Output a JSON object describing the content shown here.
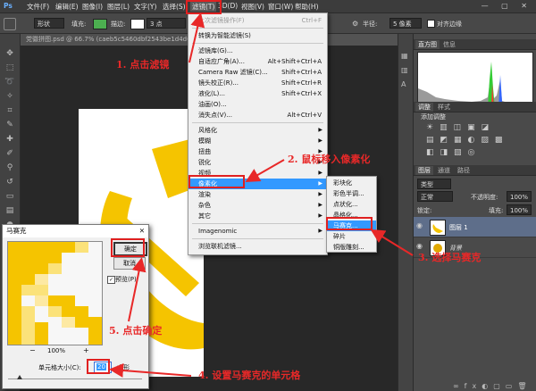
{
  "menubar": {
    "items": [
      "文件(F)",
      "编辑(E)",
      "图像(I)",
      "图层(L)",
      "文字(Y)",
      "选择(S)",
      "滤镜(T)",
      "3D(D)",
      "视图(V)",
      "窗口(W)",
      "帮助(H)"
    ],
    "window_controls": "— ▢ ✕"
  },
  "optionsbar": {
    "shape_mode": "形状",
    "fill_label": "填充:",
    "stroke_label": "描边:",
    "stroke_size": "3 点",
    "radius_label": "半径:",
    "radius_value": "5 像素",
    "align_edges_label": "对齐边缘",
    "fill_color": "#4caf50"
  },
  "document": {
    "tab_title": "党徽拼图.psd @ 66.7% (caeb5c5460dbf2543be1d4d0d..."
  },
  "filter_menu": {
    "items": [
      {
        "label": "上次滤镜操作(F)",
        "shortcut": "Ctrl+F",
        "disabled": true
      },
      {
        "label": "转换为智能滤镜(S)",
        "shortcut": ""
      },
      {
        "label": "滤镜库(G)...",
        "shortcut": ""
      },
      {
        "label": "自适应广角(A)...",
        "shortcut": "Alt+Shift+Ctrl+A"
      },
      {
        "label": "Camera Raw 滤镜(C)...",
        "shortcut": "Shift+Ctrl+A"
      },
      {
        "label": "镜头校正(R)...",
        "shortcut": "Shift+Ctrl+R"
      },
      {
        "label": "液化(L)...",
        "shortcut": "Shift+Ctrl+X"
      },
      {
        "label": "油画(O)...",
        "shortcut": ""
      },
      {
        "label": "消失点(V)...",
        "shortcut": "Alt+Ctrl+V"
      },
      {
        "label": "风格化",
        "submenu": true
      },
      {
        "label": "模糊",
        "submenu": true
      },
      {
        "label": "扭曲",
        "submenu": true
      },
      {
        "label": "锐化",
        "submenu": true
      },
      {
        "label": "视频",
        "submenu": true
      },
      {
        "label": "像素化",
        "submenu": true,
        "highlighted": true
      },
      {
        "label": "渲染",
        "submenu": true
      },
      {
        "label": "杂色",
        "submenu": true
      },
      {
        "label": "其它",
        "submenu": true
      },
      {
        "label": "Imagenomic",
        "submenu": true
      },
      {
        "label": "浏览联机滤镜...",
        "shortcut": ""
      }
    ]
  },
  "pixelate_submenu": {
    "items": [
      {
        "label": "彩块化"
      },
      {
        "label": "彩色半调..."
      },
      {
        "label": "点状化..."
      },
      {
        "label": "晶格化..."
      },
      {
        "label": "马赛克...",
        "highlighted": true
      },
      {
        "label": "碎片"
      },
      {
        "label": "铜版雕刻..."
      }
    ]
  },
  "right_panels": {
    "histogram_tabs": [
      "直方图",
      "信息"
    ],
    "adjustments_tabs": [
      "调整",
      "样式"
    ],
    "adjustments_title": "添加调整",
    "layers_tabs": [
      "图层",
      "通道",
      "路径"
    ],
    "kind_label": "类型",
    "blend_mode": "正常",
    "opacity_label": "不透明度:",
    "opacity_value": "100%",
    "lock_label": "锁定:",
    "fill_label": "填充:",
    "fill_value": "100%",
    "layers": [
      {
        "name": "图层 1",
        "selected": true
      },
      {
        "name": "背景",
        "italic": true
      }
    ]
  },
  "mosaic_dialog": {
    "title": "马赛克",
    "close": "✕",
    "ok_label": "确定",
    "cancel_label": "取消",
    "preview_label": "预览(P)",
    "zoom_value": "100%",
    "zoom_out": "−",
    "zoom_in": "+",
    "cell_size_label": "单元格大小(C):",
    "cell_size_value": "20",
    "unit": "方形"
  },
  "annotations": {
    "step1": "1. 点击滤镜",
    "step2": "2. 鼠标移入像素化",
    "step3": "3. 选择马赛克",
    "step4": "4. 设置马赛克的单元格",
    "step5": "5. 点击确定",
    "color": "#e82828"
  }
}
